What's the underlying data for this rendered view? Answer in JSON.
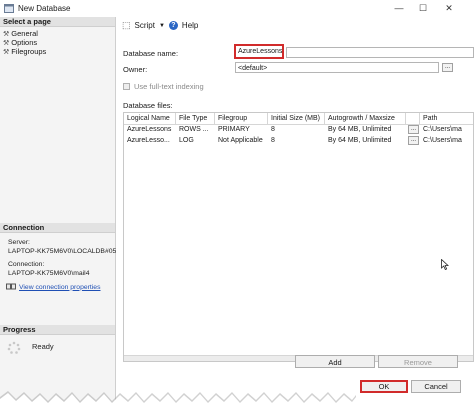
{
  "window": {
    "title": "New Database",
    "minimize": "—",
    "maximize": "☐",
    "close": "✕"
  },
  "left_pane": {
    "select_page_header": "Select a page",
    "pages": [
      {
        "label": "General",
        "icon": "wrench-icon"
      },
      {
        "label": "Options",
        "icon": "wrench-icon"
      },
      {
        "label": "Filegroups",
        "icon": "wrench-icon"
      }
    ],
    "connection_header": "Connection",
    "server_label": "Server:",
    "server_value": "LAPTOP-KK75M6V0\\LOCALDB#05",
    "connection_label": "Connection:",
    "connection_value": "LAPTOP-KK75M6V0\\mail4",
    "view_connection_link": "View connection properties",
    "progress_header": "Progress",
    "progress_status": "Ready"
  },
  "toolbar": {
    "script_label": "Script",
    "help_label": "Help"
  },
  "form": {
    "database_name_label": "Database name:",
    "database_name_value": "AzureLessons",
    "owner_label": "Owner:",
    "owner_value": "<default>",
    "fulltext_label": "Use full-text indexing",
    "database_files_label": "Database files:"
  },
  "grid": {
    "columns": [
      "Logical Name",
      "File Type",
      "Filegroup",
      "Initial Size (MB)",
      "Autogrowth / Maxsize",
      "",
      "Path"
    ],
    "rows": [
      [
        "AzureLessons",
        "ROWS ...",
        "PRIMARY",
        "8",
        "By 64 MB, Unlimited",
        "...",
        "C:\\Users\\ma"
      ],
      [
        "AzureLesso...",
        "LOG",
        "Not Applicable",
        "8",
        "By 64 MB, Unlimited",
        "...",
        "C:\\Users\\ma"
      ]
    ]
  },
  "buttons": {
    "add": "Add",
    "remove": "Remove",
    "ok": "OK",
    "cancel": "Cancel"
  }
}
